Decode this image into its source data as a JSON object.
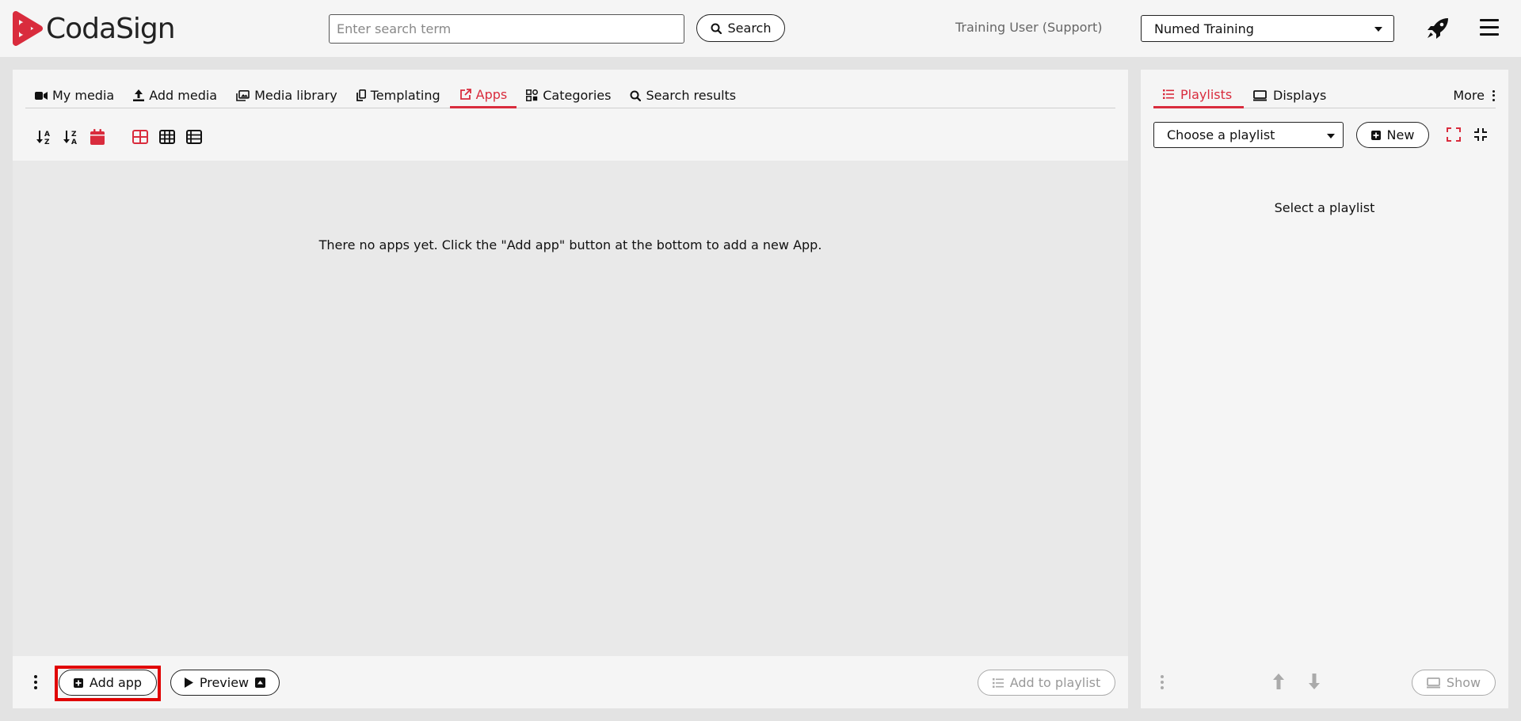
{
  "app": {
    "logo_text": "CodaSign"
  },
  "header": {
    "search_placeholder": "Enter search term",
    "search_value": "",
    "search_button": "Search",
    "user_label": "Training User (Support)",
    "org_selected": "Numed Training"
  },
  "left": {
    "tabs": [
      {
        "label": "My media",
        "icon": "video-camera-icon"
      },
      {
        "label": "Add media",
        "icon": "upload-icon"
      },
      {
        "label": "Media library",
        "icon": "images-icon"
      },
      {
        "label": "Templating",
        "icon": "copy-icon"
      },
      {
        "label": "Apps",
        "icon": "external-link-icon",
        "active": true
      },
      {
        "label": "Categories",
        "icon": "categories-icon"
      },
      {
        "label": "Search results",
        "icon": "search-icon"
      }
    ],
    "empty_message": "There no apps yet. Click the \"Add app\" button at the bottom to add a new App.",
    "add_app_button": "Add app",
    "preview_button": "Preview",
    "add_to_playlist_button": "Add to playlist"
  },
  "right": {
    "tabs": {
      "playlists": "Playlists",
      "displays": "Displays",
      "more": "More"
    },
    "playlist_select": "Choose a playlist",
    "new_button": "New",
    "empty_message": "Select a playlist",
    "show_button": "Show"
  },
  "colors": {
    "accent": "#d92c3d",
    "highlight_frame": "#e00000"
  }
}
